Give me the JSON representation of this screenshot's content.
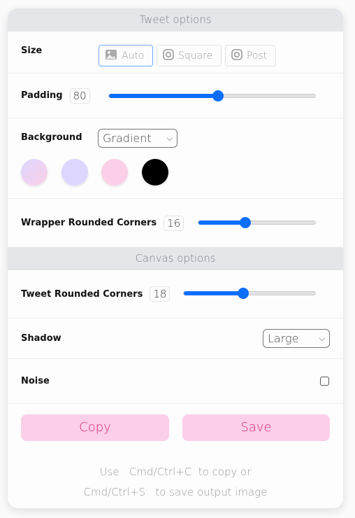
{
  "tweet_options": {
    "title": "Tweet options",
    "size": {
      "label": "Size",
      "options": [
        {
          "label": "Auto",
          "icon": "image-icon",
          "selected": true
        },
        {
          "label": "Square",
          "icon": "instagram-icon"
        },
        {
          "label": "Post",
          "icon": "instagram-icon"
        }
      ]
    },
    "padding": {
      "label": "Padding",
      "value": "80",
      "fraction": 0.53
    },
    "background": {
      "label": "Background",
      "selected": "Gradient",
      "swatches": [
        "#e9d0f0",
        "#ddd6fe",
        "#fbcfe8",
        "#000000"
      ]
    },
    "wrapper_corners": {
      "label": "Wrapper Rounded Corners",
      "value": "16",
      "fraction": 0.4
    }
  },
  "canvas_options": {
    "title": "Canvas options",
    "tweet_corners": {
      "label": "Tweet Rounded Corners",
      "value": "18",
      "fraction": 0.45
    },
    "shadow": {
      "label": "Shadow",
      "selected": "Large"
    },
    "noise": {
      "label": "Noise",
      "checked": false
    }
  },
  "actions": {
    "copy": "Copy",
    "save": "Save"
  },
  "footer": {
    "use": "Use",
    "copy_key": "Cmd/Ctrl+C",
    "copy_text": "to copy or",
    "save_key": "Cmd/Ctrl+S",
    "save_text": "to save output image"
  },
  "colors": {
    "accent": "#0d6efd",
    "button_bg": "#fbcfe8",
    "button_text": "#db2777"
  }
}
